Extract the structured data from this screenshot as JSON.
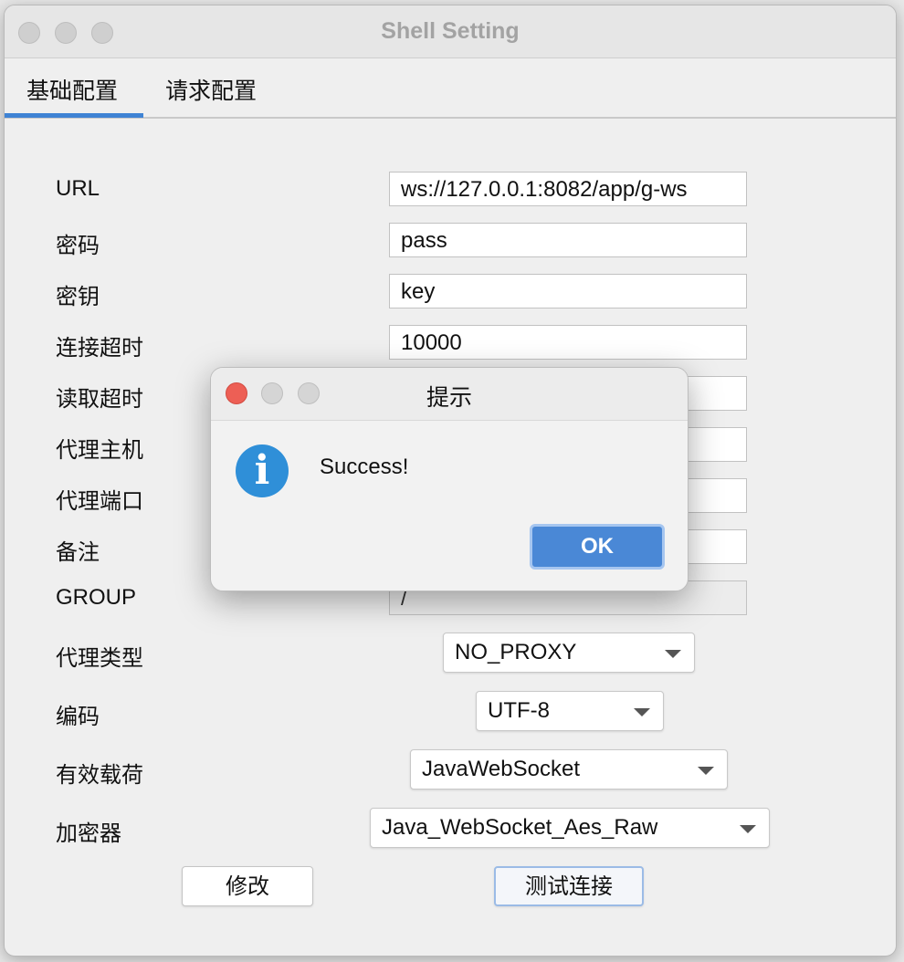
{
  "window": {
    "title": "Shell Setting"
  },
  "tabs": [
    {
      "label": "基础配置",
      "active": true
    },
    {
      "label": "请求配置",
      "active": false
    }
  ],
  "form": {
    "url": {
      "label": "URL",
      "value": "ws://127.0.0.1:8082/app/g-ws"
    },
    "password": {
      "label": "密码",
      "value": "pass"
    },
    "key": {
      "label": "密钥",
      "value": "key"
    },
    "connect_timeout": {
      "label": "连接超时",
      "value": "10000"
    },
    "read_timeout": {
      "label": "读取超时",
      "value": ""
    },
    "proxy_host": {
      "label": "代理主机",
      "value": ""
    },
    "proxy_port": {
      "label": "代理端口",
      "value": ""
    },
    "remark": {
      "label": "备注",
      "value": ""
    },
    "group": {
      "label": "GROUP",
      "value": "/"
    },
    "proxy_type": {
      "label": "代理类型",
      "value": "NO_PROXY"
    },
    "encoding": {
      "label": "编码",
      "value": "UTF-8"
    },
    "payload": {
      "label": "有效载荷",
      "value": "JavaWebSocket"
    },
    "cryption": {
      "label": "加密器",
      "value": "Java_WebSocket_Aes_Raw"
    }
  },
  "buttons": {
    "modify": "修改",
    "test_connection": "测试连接"
  },
  "dialog": {
    "title": "提示",
    "icon": "info-icon",
    "message": "Success!",
    "ok_label": "OK"
  },
  "colors": {
    "accent": "#3f83d4",
    "ok_button": "#4a88d6",
    "info_icon": "#2f8fd8",
    "close_dot": "#ed5f55"
  }
}
